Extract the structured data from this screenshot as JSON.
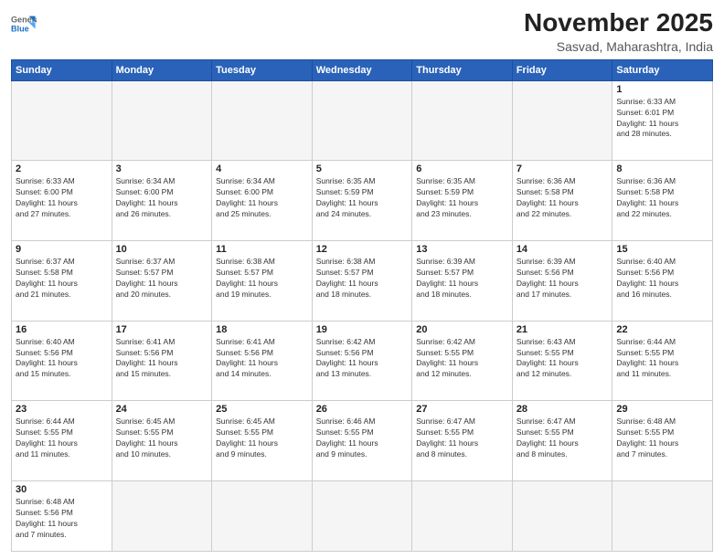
{
  "header": {
    "logo_general": "General",
    "logo_blue": "Blue",
    "month": "November 2025",
    "location": "Sasvad, Maharashtra, India"
  },
  "weekdays": [
    "Sunday",
    "Monday",
    "Tuesday",
    "Wednesday",
    "Thursday",
    "Friday",
    "Saturday"
  ],
  "weeks": [
    [
      {
        "day": "",
        "info": ""
      },
      {
        "day": "",
        "info": ""
      },
      {
        "day": "",
        "info": ""
      },
      {
        "day": "",
        "info": ""
      },
      {
        "day": "",
        "info": ""
      },
      {
        "day": "",
        "info": ""
      },
      {
        "day": "1",
        "info": "Sunrise: 6:33 AM\nSunset: 6:01 PM\nDaylight: 11 hours\nand 28 minutes."
      }
    ],
    [
      {
        "day": "2",
        "info": "Sunrise: 6:33 AM\nSunset: 6:00 PM\nDaylight: 11 hours\nand 27 minutes."
      },
      {
        "day": "3",
        "info": "Sunrise: 6:34 AM\nSunset: 6:00 PM\nDaylight: 11 hours\nand 26 minutes."
      },
      {
        "day": "4",
        "info": "Sunrise: 6:34 AM\nSunset: 6:00 PM\nDaylight: 11 hours\nand 25 minutes."
      },
      {
        "day": "5",
        "info": "Sunrise: 6:35 AM\nSunset: 5:59 PM\nDaylight: 11 hours\nand 24 minutes."
      },
      {
        "day": "6",
        "info": "Sunrise: 6:35 AM\nSunset: 5:59 PM\nDaylight: 11 hours\nand 23 minutes."
      },
      {
        "day": "7",
        "info": "Sunrise: 6:36 AM\nSunset: 5:58 PM\nDaylight: 11 hours\nand 22 minutes."
      },
      {
        "day": "8",
        "info": "Sunrise: 6:36 AM\nSunset: 5:58 PM\nDaylight: 11 hours\nand 22 minutes."
      }
    ],
    [
      {
        "day": "9",
        "info": "Sunrise: 6:37 AM\nSunset: 5:58 PM\nDaylight: 11 hours\nand 21 minutes."
      },
      {
        "day": "10",
        "info": "Sunrise: 6:37 AM\nSunset: 5:57 PM\nDaylight: 11 hours\nand 20 minutes."
      },
      {
        "day": "11",
        "info": "Sunrise: 6:38 AM\nSunset: 5:57 PM\nDaylight: 11 hours\nand 19 minutes."
      },
      {
        "day": "12",
        "info": "Sunrise: 6:38 AM\nSunset: 5:57 PM\nDaylight: 11 hours\nand 18 minutes."
      },
      {
        "day": "13",
        "info": "Sunrise: 6:39 AM\nSunset: 5:57 PM\nDaylight: 11 hours\nand 18 minutes."
      },
      {
        "day": "14",
        "info": "Sunrise: 6:39 AM\nSunset: 5:56 PM\nDaylight: 11 hours\nand 17 minutes."
      },
      {
        "day": "15",
        "info": "Sunrise: 6:40 AM\nSunset: 5:56 PM\nDaylight: 11 hours\nand 16 minutes."
      }
    ],
    [
      {
        "day": "16",
        "info": "Sunrise: 6:40 AM\nSunset: 5:56 PM\nDaylight: 11 hours\nand 15 minutes."
      },
      {
        "day": "17",
        "info": "Sunrise: 6:41 AM\nSunset: 5:56 PM\nDaylight: 11 hours\nand 15 minutes."
      },
      {
        "day": "18",
        "info": "Sunrise: 6:41 AM\nSunset: 5:56 PM\nDaylight: 11 hours\nand 14 minutes."
      },
      {
        "day": "19",
        "info": "Sunrise: 6:42 AM\nSunset: 5:56 PM\nDaylight: 11 hours\nand 13 minutes."
      },
      {
        "day": "20",
        "info": "Sunrise: 6:42 AM\nSunset: 5:55 PM\nDaylight: 11 hours\nand 12 minutes."
      },
      {
        "day": "21",
        "info": "Sunrise: 6:43 AM\nSunset: 5:55 PM\nDaylight: 11 hours\nand 12 minutes."
      },
      {
        "day": "22",
        "info": "Sunrise: 6:44 AM\nSunset: 5:55 PM\nDaylight: 11 hours\nand 11 minutes."
      }
    ],
    [
      {
        "day": "23",
        "info": "Sunrise: 6:44 AM\nSunset: 5:55 PM\nDaylight: 11 hours\nand 11 minutes."
      },
      {
        "day": "24",
        "info": "Sunrise: 6:45 AM\nSunset: 5:55 PM\nDaylight: 11 hours\nand 10 minutes."
      },
      {
        "day": "25",
        "info": "Sunrise: 6:45 AM\nSunset: 5:55 PM\nDaylight: 11 hours\nand 9 minutes."
      },
      {
        "day": "26",
        "info": "Sunrise: 6:46 AM\nSunset: 5:55 PM\nDaylight: 11 hours\nand 9 minutes."
      },
      {
        "day": "27",
        "info": "Sunrise: 6:47 AM\nSunset: 5:55 PM\nDaylight: 11 hours\nand 8 minutes."
      },
      {
        "day": "28",
        "info": "Sunrise: 6:47 AM\nSunset: 5:55 PM\nDaylight: 11 hours\nand 8 minutes."
      },
      {
        "day": "29",
        "info": "Sunrise: 6:48 AM\nSunset: 5:55 PM\nDaylight: 11 hours\nand 7 minutes."
      }
    ],
    [
      {
        "day": "30",
        "info": "Sunrise: 6:48 AM\nSunset: 5:56 PM\nDaylight: 11 hours\nand 7 minutes."
      },
      {
        "day": "",
        "info": ""
      },
      {
        "day": "",
        "info": ""
      },
      {
        "day": "",
        "info": ""
      },
      {
        "day": "",
        "info": ""
      },
      {
        "day": "",
        "info": ""
      },
      {
        "day": "",
        "info": ""
      }
    ]
  ]
}
